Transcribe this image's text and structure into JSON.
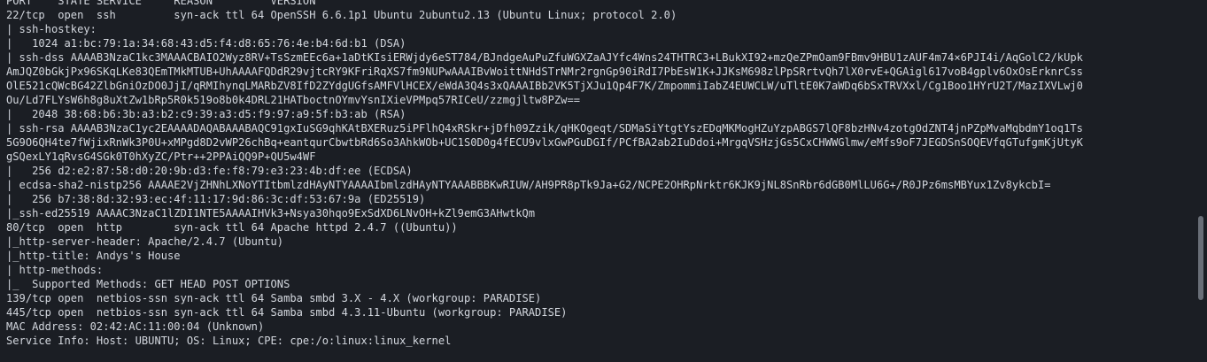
{
  "terminal": {
    "lines": [
      "PORT    STATE SERVICE     REASON         VERSION",
      "22/tcp  open  ssh         syn-ack ttl 64 OpenSSH 6.6.1p1 Ubuntu 2ubuntu2.13 (Ubuntu Linux; protocol 2.0)",
      "| ssh-hostkey: ",
      "|   1024 a1:bc:79:1a:34:68:43:d5:f4:d8:65:76:4e:b4:6d:b1 (DSA)",
      "| ssh-dss AAAAB3NzaC1kc3MAAACBAIO2Wyz8RV+TsSzmEEc6a+1aDtKIsiERWjdy6eST784/BJndgeAuPuZfuWGXZaAJYfc4Wns24THTRC3+LBukXI92+mzQeZPmOam9FBmv9HBU1zAUF4m74×6PJI4i/AqGolC2/kUpk",
      "AmJQZ0bGkjPx96SKqLKe83QEmTMkMTUB+UhAAAAFQDdR29vjtcRY9KFriRqXS7fm9NUPwAAAIBvWoittNHdSTrNMr2rgnGp90iRdI7PbEsW1K+JJKsM698zlPpSRrtvQh7lX0rvE+QGAigl617voB4gplv6OxOsErknrCss",
      "OlE521cQWcBG42ZlbGniOzDO0JjI/qRMIhynqLMARbZV8IfD2ZYdgUGfsAMFVlHCEX/eWdA3Q4s3xQAAAIBb2VK5TjXJu1Qp4F7K/ZmpommiIabZ4EUWCLW/uTltE0K7aWDq6bSxTRVXxl/Cg1Boo1HYrU2T/MazIXVLwj0",
      "Ou/Ld7FLYsW6h8g8uXtZw1bRp5R0k519o8b0k4DRL21HATboctnOYmvYsnIXieVPMpq57RICeU/zzmgjltw8PZw==",
      "|   2048 38:68:b6:3b:a3:b2:c9:39:a3:d5:f9:97:a9:5f:b3:ab (RSA)",
      "| ssh-rsa AAAAB3NzaC1yc2EAAAADAQABAAABAQC91gxIuSG9qhKAtBXERuz5iPFlhQ4xRSkr+jDfh09Zzik/qHKOgeqt/SDMaSiYtgtYszEDqMKMogHZuYzpABGS7lQF8bzHNv4zotgOdZNT4jnPZpMvaMqbdmY1oq1Ts",
      "5G9O6QH4te7fWjixRnWk3P0U+xMPgd8D2vWP26chBq+eantqurCbwtbRd6So3AhkWOb+UC1S0D0g4fECU9vlxGwPGuDGIf/PCfBA2ab2IuDdoi+MrgqVSHzjGs5CxCHWWGlmw/eMfs9oF7JEGDSnSOQEVfqGTufgmKjUtyK",
      "gSQexLY1qRvsG4SGk0T0hXyZC/Ptr++2PPAiQQ9P+QU5w4WF",
      "|   256 d2:e2:87:58:d0:20:9b:d3:fe:f8:79:e3:23:4b:df:ee (ECDSA)",
      "| ecdsa-sha2-nistp256 AAAAE2VjZHNhLXNoYTItbmlzdHAyNTYAAAAIbmlzdHAyNTYAAABBBKwRIUW/AH9PR8pTk9Ja+G2/NCPE2OHRpNrktr6KJK9jNL8SnRbr6dGB0MlLU6G+/R0JPz6msMBYux1Zv8ykcbI=",
      "|   256 b7:38:8d:32:93:ec:4f:11:17:9d:86:3c:df:53:67:9a (ED25519)",
      "|_ssh-ed25519 AAAAC3NzaC1lZDI1NTE5AAAAIHVk3+Nsya30hqo9ExSdXD6LNvOH+kZl9emG3AHwtkQm",
      "80/tcp  open  http        syn-ack ttl 64 Apache httpd 2.4.7 ((Ubuntu))",
      "|_http-server-header: Apache/2.4.7 (Ubuntu)",
      "|_http-title: Andys's House",
      "| http-methods: ",
      "|_  Supported Methods: GET HEAD POST OPTIONS",
      "139/tcp open  netbios-ssn syn-ack ttl 64 Samba smbd 3.X - 4.X (workgroup: PARADISE)",
      "445/tcp open  netbios-ssn syn-ack ttl 64 Samba smbd 4.3.11-Ubuntu (workgroup: PARADISE)",
      "MAC Address: 02:42:AC:11:00:04 (Unknown)",
      "Service Info: Host: UBUNTU; OS: Linux; CPE: cpe:/o:linux:linux_kernel"
    ]
  },
  "scroll": {
    "position_fraction": 0.77
  },
  "colors": {
    "background": "#1b1e24",
    "text": "#d3d7de",
    "scroll_thumb": "#6a6f78"
  }
}
